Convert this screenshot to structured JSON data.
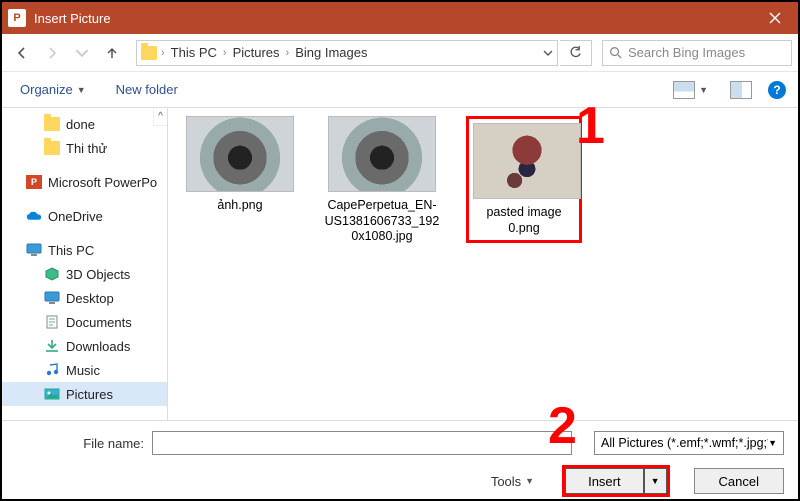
{
  "title": "Insert Picture",
  "breadcrumb": {
    "items": [
      "This PC",
      "Pictures",
      "Bing Images"
    ]
  },
  "search": {
    "placeholder": "Search Bing Images"
  },
  "toolbar": {
    "organize": "Organize",
    "newfolder": "New folder"
  },
  "sidebar": {
    "items": [
      {
        "label": "done",
        "kind": "folder",
        "level": 2
      },
      {
        "label": "Thi thử",
        "kind": "folder",
        "level": 2
      },
      {
        "label": "Microsoft PowerPo",
        "kind": "ppt",
        "level": 1
      },
      {
        "label": "OneDrive",
        "kind": "onedrive",
        "level": 1
      },
      {
        "label": "This PC",
        "kind": "monitor",
        "level": 1
      },
      {
        "label": "3D Objects",
        "kind": "obj",
        "level": 2
      },
      {
        "label": "Desktop",
        "kind": "monitor",
        "level": 2
      },
      {
        "label": "Documents",
        "kind": "doc",
        "level": 2
      },
      {
        "label": "Downloads",
        "kind": "dl",
        "level": 2
      },
      {
        "label": "Music",
        "kind": "music",
        "level": 2
      },
      {
        "label": "Pictures",
        "kind": "pic",
        "level": 2,
        "selected": true
      }
    ]
  },
  "files": [
    {
      "name": "ảnh.png",
      "thumb": "sea"
    },
    {
      "name": "CapePerpetua_EN-US1381606733_1920x1080.jpg",
      "thumb": "sea"
    },
    {
      "name": "pasted image 0.png",
      "thumb": "char",
      "highlight": true
    }
  ],
  "footer": {
    "filename_label": "File name:",
    "filetype": "All Pictures (*.emf;*.wmf;*.jpg;*.j",
    "tools": "Tools",
    "insert": "Insert",
    "cancel": "Cancel"
  },
  "annotations": {
    "one": "1",
    "two": "2"
  }
}
